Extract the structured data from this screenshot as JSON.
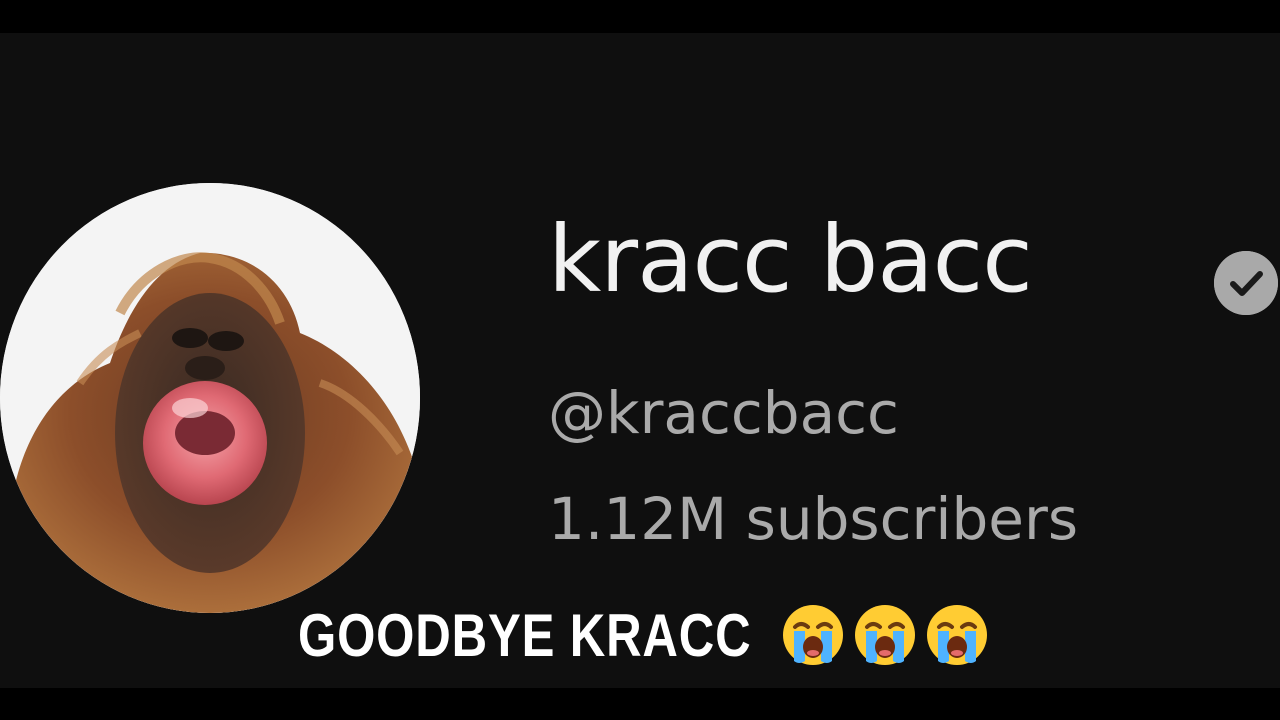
{
  "channel": {
    "name": "kracc bacc",
    "handle": "@kraccbacc",
    "subscribers": "1.12M subscribers",
    "verified_icon": "verified-check-icon",
    "avatar": "orangutan-avatar"
  },
  "caption": {
    "text": "GOODBYE KRACC",
    "emojis": [
      "loudly-crying-face-icon",
      "loudly-crying-face-icon",
      "loudly-crying-face-icon"
    ]
  },
  "colors": {
    "background": "#0f0f0f",
    "name": "#f1f1f1",
    "secondary_text": "#aaaaaa",
    "verified_badge": "#a9a9a9",
    "caption": "#ffffff"
  }
}
